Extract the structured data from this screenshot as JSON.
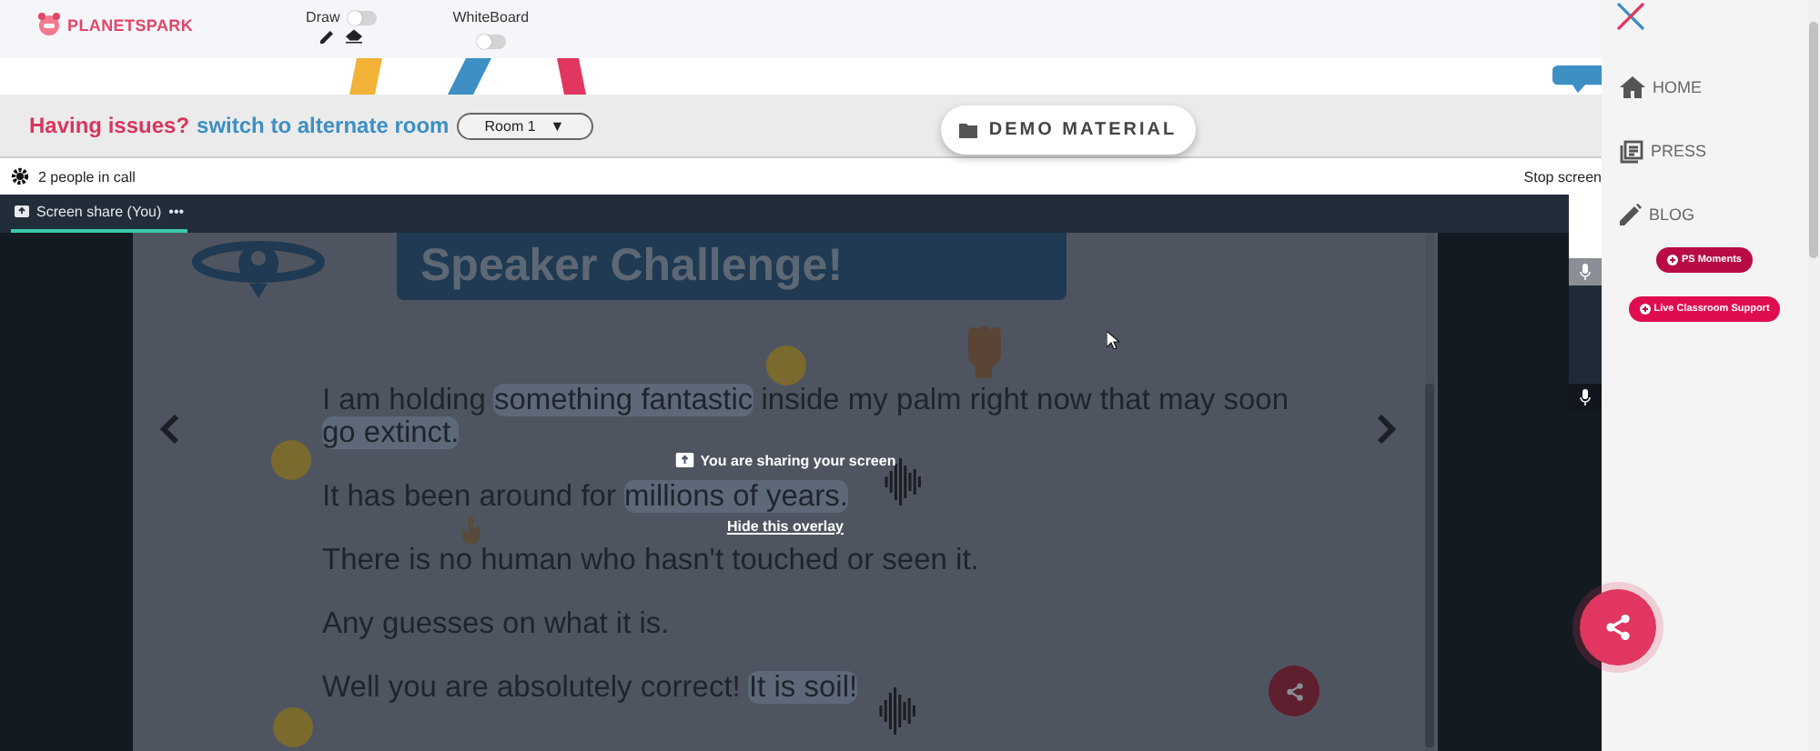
{
  "header": {
    "logo": "PLANETSPARK",
    "toggles": [
      {
        "label": "Draw",
        "on": false
      },
      {
        "label": "WhiteBoard",
        "on": false
      }
    ]
  },
  "issues_bar": {
    "prompt": "Having issues?",
    "link": "switch to alternate room",
    "room_select": {
      "value": "Room 1",
      "caret": "▼"
    },
    "demo_button": "DEMO MATERIAL"
  },
  "call_bar": {
    "people": "2 people in call",
    "stop": "Stop screen"
  },
  "tabs": [
    {
      "label": "Screen share (You)",
      "selected": true,
      "menu": "•••"
    }
  ],
  "slide": {
    "title": "Speaker Challenge!",
    "lines": [
      {
        "segments": [
          {
            "text": "I am holding ",
            "highlight": false
          },
          {
            "text": "something fantastic",
            "highlight": true
          },
          {
            "text": " inside my palm right now that may soon ",
            "highlight": false
          },
          {
            "text": "go extinct.",
            "highlight": true
          }
        ]
      },
      {
        "segments": [
          {
            "text": "It has been around for ",
            "highlight": false
          },
          {
            "text": "millions of years.",
            "highlight": true
          }
        ]
      },
      {
        "segments": [
          {
            "text": "There is no human who hasn't touched or seen it.",
            "highlight": false
          }
        ]
      },
      {
        "segments": [
          {
            "text": "Any guesses on what it is.",
            "highlight": false
          }
        ]
      },
      {
        "segments": [
          {
            "text": "Well you are absolutely correct! ",
            "highlight": false
          },
          {
            "text": "It is soil!",
            "highlight": true
          }
        ]
      }
    ]
  },
  "share_overlay": {
    "message": "You are sharing your screen",
    "link": "Hide this overlay"
  },
  "sidebar": {
    "items": [
      {
        "label": "HOME"
      },
      {
        "label": "PRESS"
      },
      {
        "label": "BLOG"
      }
    ],
    "pills": [
      "PS Moments",
      "Live Classroom Support"
    ]
  }
}
